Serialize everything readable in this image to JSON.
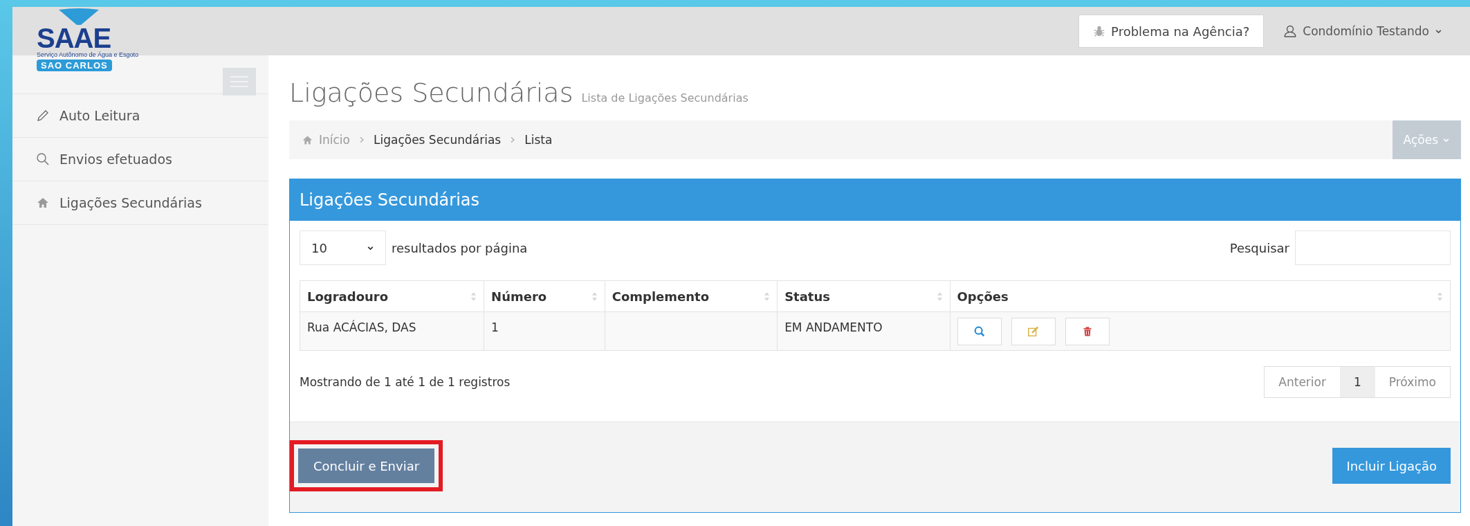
{
  "logo": {
    "name": "SAAE",
    "subtitle": "Serviço Autônomo de Água e Esgoto",
    "city": "SAO CARLOS"
  },
  "header": {
    "report_button": "Problema na Agência?",
    "user": "Condomínio Testando"
  },
  "sidebar": {
    "items": [
      {
        "label": "Auto Leitura"
      },
      {
        "label": "Envios efetuados"
      },
      {
        "label": "Ligações Secundárias"
      }
    ]
  },
  "page": {
    "title": "Ligações Secundárias",
    "subtitle": "Lista de Ligações Secundárias"
  },
  "breadcrumb": [
    {
      "label": "Início"
    },
    {
      "label": "Ligações Secundárias"
    },
    {
      "label": "Lista"
    }
  ],
  "actions_button": "Ações",
  "panel": {
    "title": "Ligações Secundárias",
    "page_size": "10",
    "page_size_label": "resultados por página",
    "search_label": "Pesquisar",
    "table": {
      "columns": [
        "Logradouro",
        "Número",
        "Complemento",
        "Status",
        "Opções"
      ],
      "rows": [
        {
          "logradouro": "Rua ACÁCIAS, DAS",
          "numero": "1",
          "status": "EM ANDAMENTO"
        }
      ]
    },
    "info": "Mostrando de 1 até 1 de 1 registros",
    "pagination": {
      "previous": "Anterior",
      "pages": [
        {
          "label": "1",
          "selected": true
        }
      ],
      "next": "Próximo"
    },
    "submit_button": {
      "label": "Concluir e Enviar",
      "highlighted": true
    },
    "add_button": "Incluir Ligação"
  }
}
